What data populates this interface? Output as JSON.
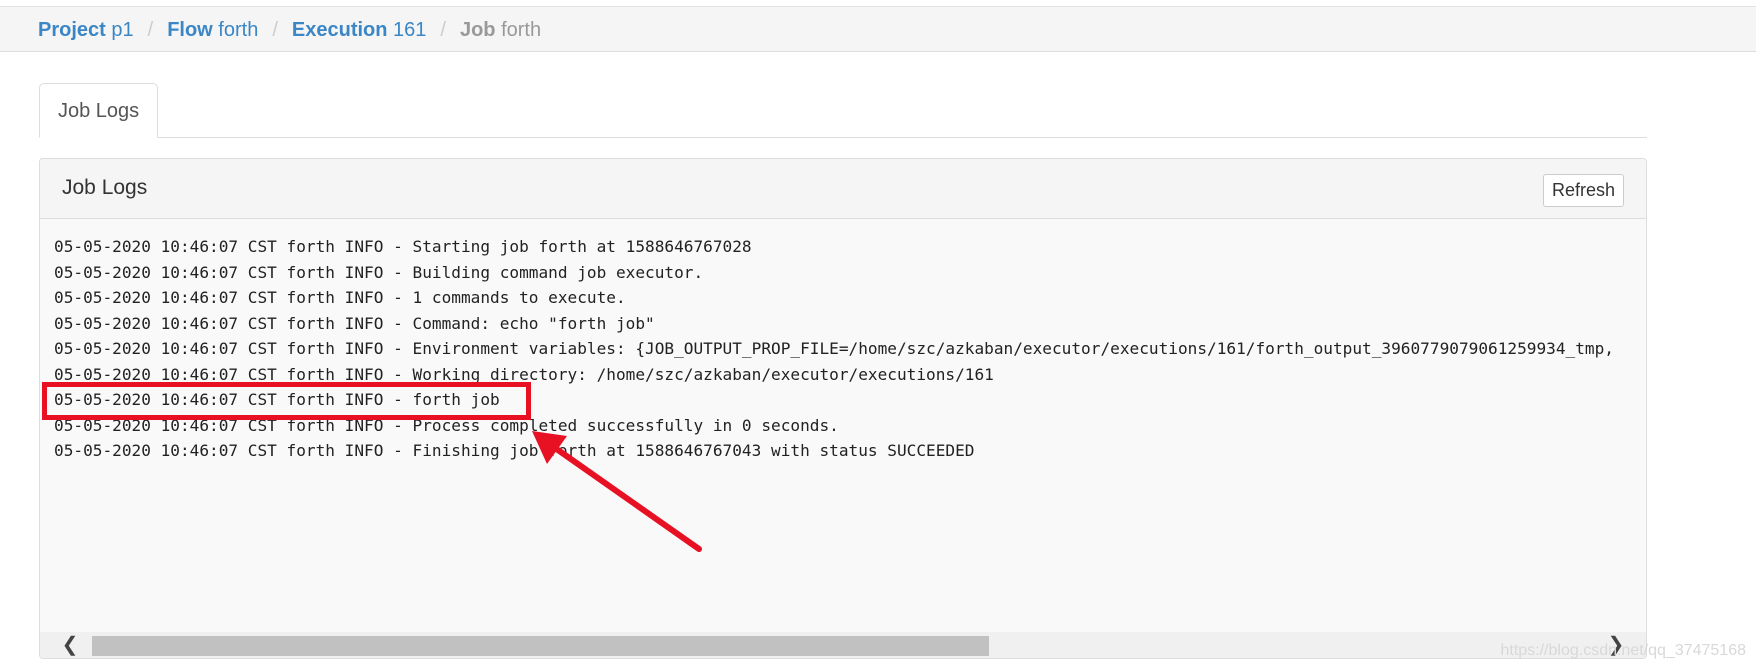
{
  "breadcrumb": [
    {
      "label": "Project",
      "value": "p1"
    },
    {
      "label": "Flow",
      "value": "forth"
    },
    {
      "label": "Execution",
      "value": "161"
    },
    {
      "label": "Job",
      "value": "forth"
    }
  ],
  "breadcrumb_separator": "/",
  "tabs": [
    {
      "label": "Job Logs"
    }
  ],
  "panel": {
    "title": "Job Logs",
    "refresh_label": "Refresh"
  },
  "log_lines": [
    "05-05-2020 10:46:07 CST forth INFO - Starting job forth at 1588646767028",
    "05-05-2020 10:46:07 CST forth INFO - Building command job executor.",
    "05-05-2020 10:46:07 CST forth INFO - 1 commands to execute.",
    "05-05-2020 10:46:07 CST forth INFO - Command: echo \"forth job\"",
    "05-05-2020 10:46:07 CST forth INFO - Environment variables: {JOB_OUTPUT_PROP_FILE=/home/szc/azkaban/executor/executions/161/forth_output_3960779079061259934_tmp,",
    "05-05-2020 10:46:07 CST forth INFO - Working directory: /home/szc/azkaban/executor/executions/161",
    "05-05-2020 10:46:07 CST forth INFO - forth job",
    "05-05-2020 10:46:07 CST forth INFO - Process completed successfully in 0 seconds.",
    "05-05-2020 10:46:07 CST forth INFO - Finishing job forth at 1588646767043 with status SUCCEEDED"
  ],
  "scrollbar": {
    "left_icon": "chevron-left-icon",
    "right_icon": "chevron-right-icon",
    "left_glyph": "❮",
    "right_glyph": "❯"
  },
  "annotation": {
    "color": "#e81123"
  },
  "watermark": "https://blog.csdn.net/qq_37475168",
  "colors": {
    "link": "#3a86c6",
    "active_crumb": "#999999"
  }
}
